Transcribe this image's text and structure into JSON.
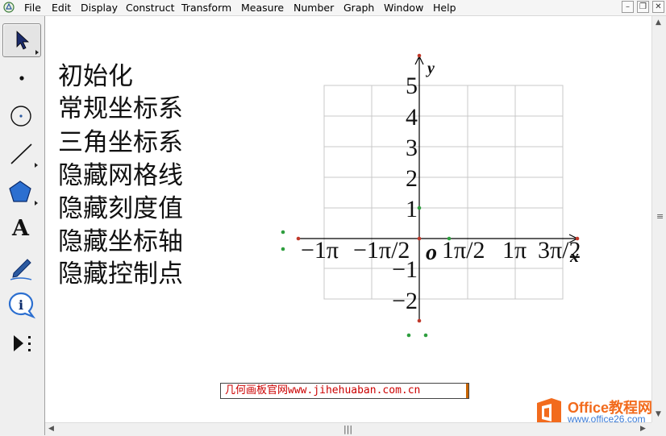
{
  "menubar": {
    "items": [
      "File",
      "Edit",
      "Display",
      "Construct",
      "Transform",
      "Measure",
      "Number",
      "Graph",
      "Window",
      "Help"
    ]
  },
  "window_controls": [
    "minimize",
    "restore",
    "close"
  ],
  "toolbar": {
    "tools": [
      {
        "name": "arrow-select-tool",
        "icon": "arrow-pointer-icon",
        "active": true
      },
      {
        "name": "point-tool",
        "icon": "dot-icon"
      },
      {
        "name": "compass-tool",
        "icon": "circle-icon"
      },
      {
        "name": "straightedge-tool",
        "icon": "line-segment-icon"
      },
      {
        "name": "polygon-tool",
        "icon": "pentagon-icon"
      },
      {
        "name": "text-tool",
        "icon": "letter-a-icon",
        "glyph": "A"
      },
      {
        "name": "marker-tool",
        "icon": "pen-icon"
      },
      {
        "name": "information-tool",
        "icon": "info-icon",
        "glyph": "i"
      },
      {
        "name": "custom-tool",
        "icon": "play-more-icon"
      }
    ]
  },
  "action_buttons": [
    "初始化",
    "常规坐标系",
    "三角坐标系",
    "隐藏网格线",
    "隐藏刻度值",
    "隐藏坐标轴",
    "隐藏控制点"
  ],
  "plot": {
    "y_axis_label": "y",
    "x_axis_label": "x",
    "origin_label": "o",
    "y_tick_labels": [
      "5",
      "4",
      "3",
      "2",
      "1",
      "−1",
      "−2"
    ],
    "x_tick_labels": [
      "−1π",
      "−1π/2",
      "1π/2",
      "1π",
      "3π/2"
    ],
    "axis_color": "#000000",
    "grid_color": "#c8c8c8",
    "control_point_red": "#c0392b",
    "control_point_green": "#2e9e3e"
  },
  "caption": {
    "text_cn": "几何画板官网",
    "text_url": "www.jihehuaban.com.cn"
  },
  "watermark": {
    "brand": "Office教程网",
    "url": "www.office26.com",
    "brand_color": "#f26b1d",
    "url_color": "#3b7bd6"
  }
}
